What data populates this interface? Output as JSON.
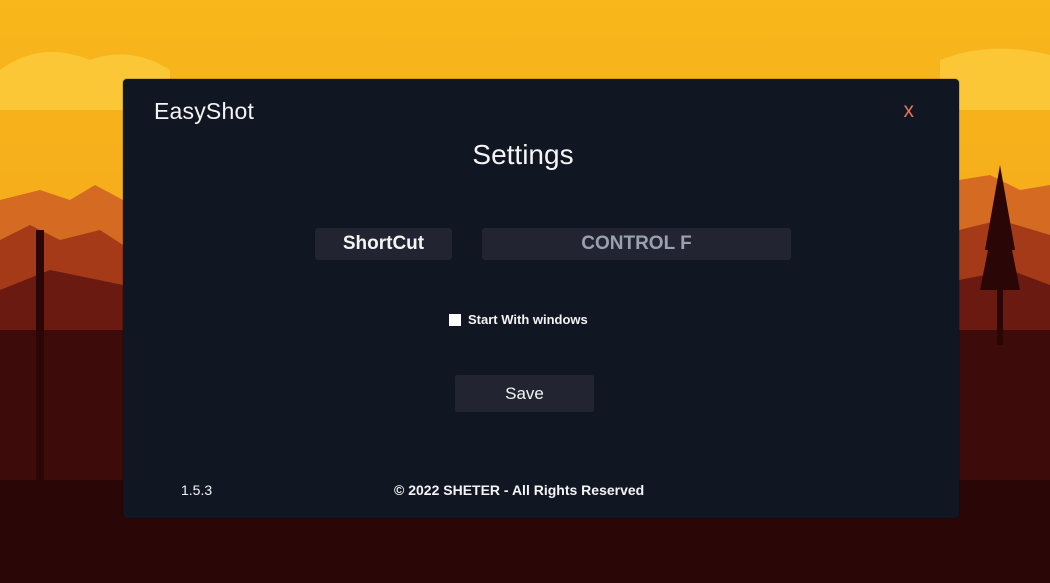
{
  "wallpaper": {
    "sky_top": "#f7b21a",
    "sky_bottom": "#f19a1c",
    "mountain_far": "#c2531e",
    "mountain_mid": "#8f2b16",
    "ground_dark": "#3d0b09",
    "ground_darkest": "#220506"
  },
  "dialog": {
    "app_title": "EasyShot",
    "close_label": "x",
    "heading": "Settings",
    "shortcut": {
      "label": "ShortCut",
      "value": "CONTROL F"
    },
    "startup": {
      "label": "Start With windows",
      "checked": false
    },
    "save_label": "Save",
    "footer": {
      "version": "1.5.3",
      "copyright": "© 2022 SHETER - All Rights Reserved"
    },
    "colors": {
      "background": "#111623",
      "control_bg": "#222432",
      "close": "#e8735a",
      "text": "#f4f4f4",
      "muted_text": "#9aa0b0"
    }
  }
}
